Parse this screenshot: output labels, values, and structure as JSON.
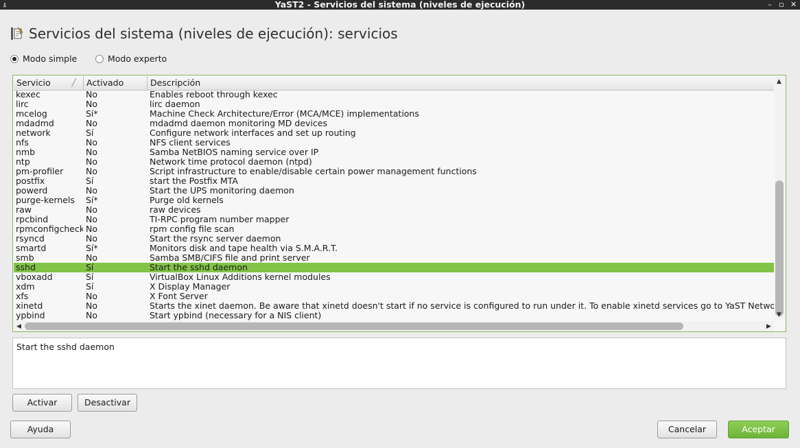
{
  "window": {
    "title": "YaST2 - Servicios del sistema (niveles de ejecución)",
    "left_glyph": "⍋",
    "controls": [
      "–",
      "▫",
      "✕"
    ]
  },
  "header": {
    "title": "Servicios del sistema (niveles de ejecución): servicios",
    "icon": "runlevel-editor-icon"
  },
  "mode": {
    "simple_label": "Modo simple",
    "expert_label": "Modo experto",
    "selected": "simple"
  },
  "table": {
    "columns": [
      "Servicio",
      "Activado",
      "Descripción"
    ],
    "sort_indicator": "╱",
    "rows": [
      {
        "service": "kexec",
        "enabled": "No",
        "description": "Enables reboot through kexec"
      },
      {
        "service": "lirc",
        "enabled": "No",
        "description": "lirc daemon"
      },
      {
        "service": "mcelog",
        "enabled": "Sí*",
        "description": "Machine Check Architecture/Error (MCA/MCE) implementations"
      },
      {
        "service": "mdadmd",
        "enabled": "No",
        "description": "mdadmd daemon monitoring MD devices"
      },
      {
        "service": "network",
        "enabled": "Sí",
        "description": "Configure network interfaces and set up routing"
      },
      {
        "service": "nfs",
        "enabled": "No",
        "description": "NFS client services"
      },
      {
        "service": "nmb",
        "enabled": "No",
        "description": "Samba NetBIOS naming service over IP"
      },
      {
        "service": "ntp",
        "enabled": "No",
        "description": "Network time protocol daemon (ntpd)"
      },
      {
        "service": "pm-profiler",
        "enabled": "No",
        "description": "Script infrastructure to enable/disable certain power management functions"
      },
      {
        "service": "postfix",
        "enabled": "Sí",
        "description": "start the Postfix MTA"
      },
      {
        "service": "powerd",
        "enabled": "No",
        "description": "Start the UPS monitoring daemon"
      },
      {
        "service": "purge-kernels",
        "enabled": "Sí*",
        "description": "Purge old kernels"
      },
      {
        "service": "raw",
        "enabled": "No",
        "description": "raw devices"
      },
      {
        "service": "rpcbind",
        "enabled": "No",
        "description": "TI-RPC program number mapper"
      },
      {
        "service": "rpmconfigcheck",
        "enabled": "No",
        "description": "rpm config file scan"
      },
      {
        "service": "rsyncd",
        "enabled": "No",
        "description": "Start the rsync server daemon"
      },
      {
        "service": "smartd",
        "enabled": "Sí*",
        "description": "Monitors disk and tape health via S.M.A.R.T."
      },
      {
        "service": "smb",
        "enabled": "No",
        "description": "Samba SMB/CIFS file and print server"
      },
      {
        "service": "sshd",
        "enabled": "Sí",
        "description": "Start the sshd daemon"
      },
      {
        "service": "vboxadd",
        "enabled": "Sí",
        "description": "VirtualBox Linux Additions kernel modules"
      },
      {
        "service": "xdm",
        "enabled": "Sí",
        "description": "X Display Manager"
      },
      {
        "service": "xfs",
        "enabled": "No",
        "description": "X Font Server"
      },
      {
        "service": "xinetd",
        "enabled": "No",
        "description": "Starts the xinet daemon.  Be aware that xinetd doesn't start if no service is configured to run under it.  To enable xinetd services go to YaST Network Services (xinetd)"
      },
      {
        "service": "ypbind",
        "enabled": "No",
        "description": "Start ypbind (necessary for a NIS client)"
      }
    ],
    "selected_index": 18,
    "selection_color": "#83c348"
  },
  "detail": {
    "text": "Start the sshd daemon"
  },
  "buttons": {
    "enable": "Activar",
    "disable": "Desactivar",
    "help": "Ayuda",
    "cancel": "Cancelar",
    "accept": "Aceptar"
  },
  "colors": {
    "accent": "#7dbd45",
    "title_bar": "#2b2b2b"
  }
}
